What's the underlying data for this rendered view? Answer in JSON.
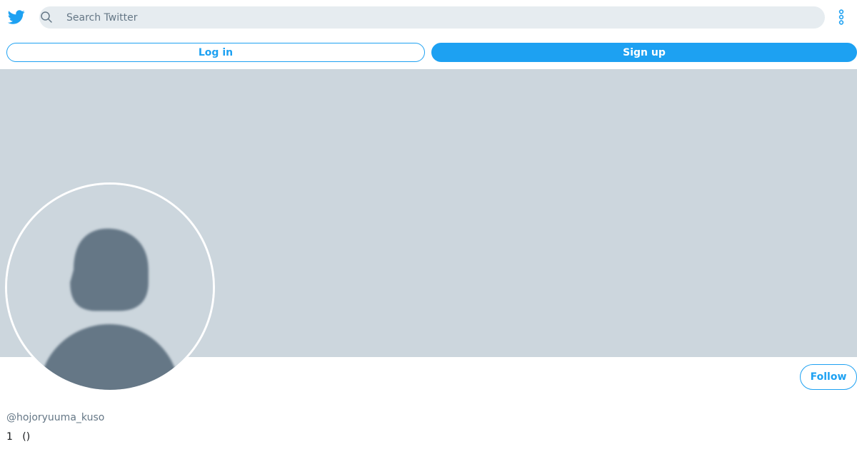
{
  "header": {
    "search": {
      "placeholder": "Search Twitter",
      "value": ""
    },
    "icons": {
      "logo": "twitter-bird-icon",
      "search": "search-icon",
      "more": "more-vertical-icon"
    }
  },
  "auth": {
    "login_label": "Log in",
    "signup_label": "Sign up"
  },
  "profile": {
    "follow_label": "Follow",
    "handle": "@hojoryuuma_kuso",
    "bio": "1   ()"
  },
  "colors": {
    "accent": "#1da1f2",
    "banner": "#ccd6dd",
    "avatar_figure": "#657786",
    "search_bg": "#e6ecf0",
    "secondary_text": "#657786"
  }
}
